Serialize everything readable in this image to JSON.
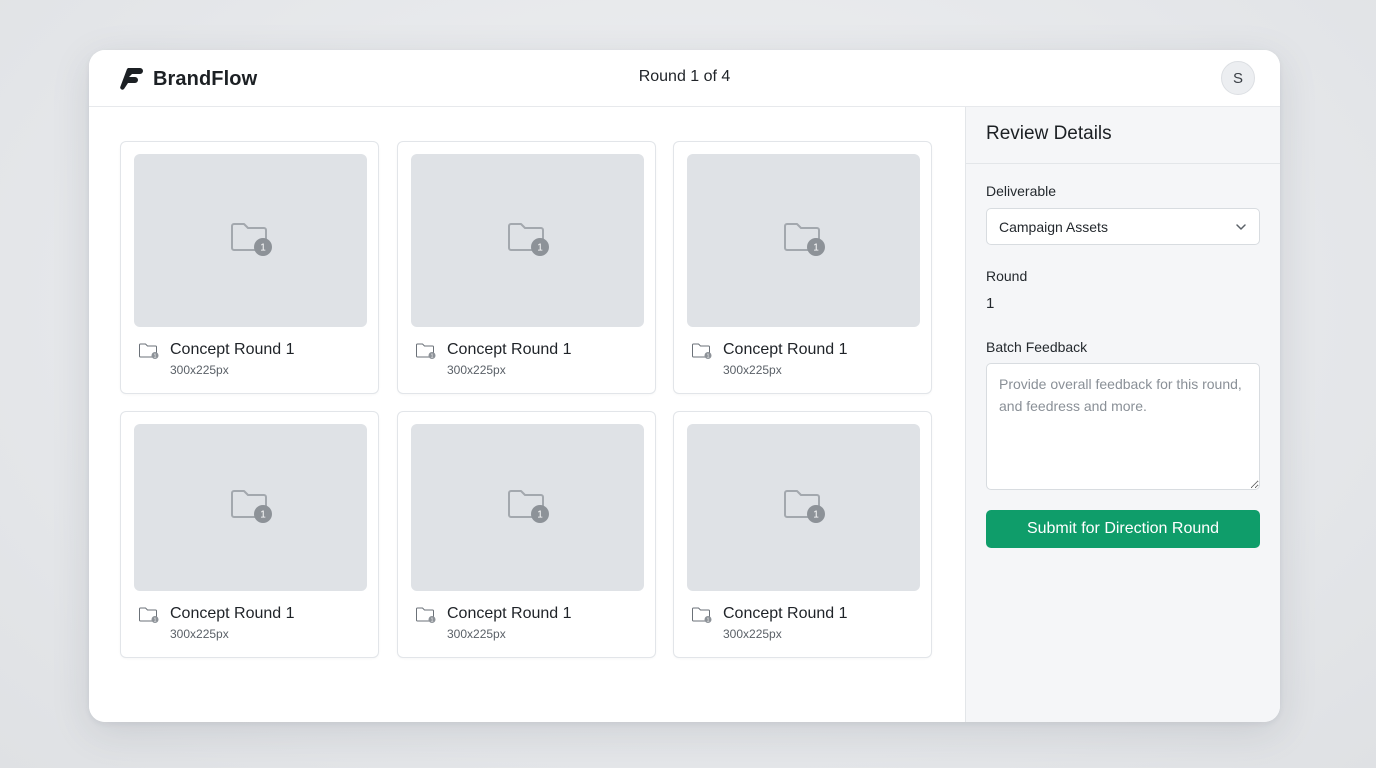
{
  "app": {
    "brand_name": "BrandFlow",
    "round_indicator": "Round 1 of 4",
    "avatar_initial": "S",
    "accent_color": "#0f9d6a"
  },
  "gallery": {
    "items": [
      {
        "title": "Concept Round 1",
        "dimensions": "300x225px",
        "icon": "folder-info-icon"
      },
      {
        "title": "Concept Round 1",
        "dimensions": "300x225px",
        "icon": "folder-info-icon"
      },
      {
        "title": "Concept Round 1",
        "dimensions": "300x225px",
        "icon": "folder-info-icon"
      },
      {
        "title": "Concept Round 1",
        "dimensions": "300x225px",
        "icon": "folder-info-icon"
      },
      {
        "title": "Concept Round 1",
        "dimensions": "300x225px",
        "icon": "folder-info-icon"
      },
      {
        "title": "Concept Round 1",
        "dimensions": "300x225px",
        "icon": "folder-info-icon"
      }
    ]
  },
  "review": {
    "title": "Review Details",
    "deliverable_label": "Deliverable",
    "deliverable_value": "Campaign Assets",
    "round_label": "Round",
    "round_value": "1",
    "feedback_label": "Batch Feedback",
    "feedback_placeholder": "Provide overall feedback for this round, and feedress and more.",
    "feedback_value": "",
    "submit_label": "Submit for Direction Round"
  }
}
